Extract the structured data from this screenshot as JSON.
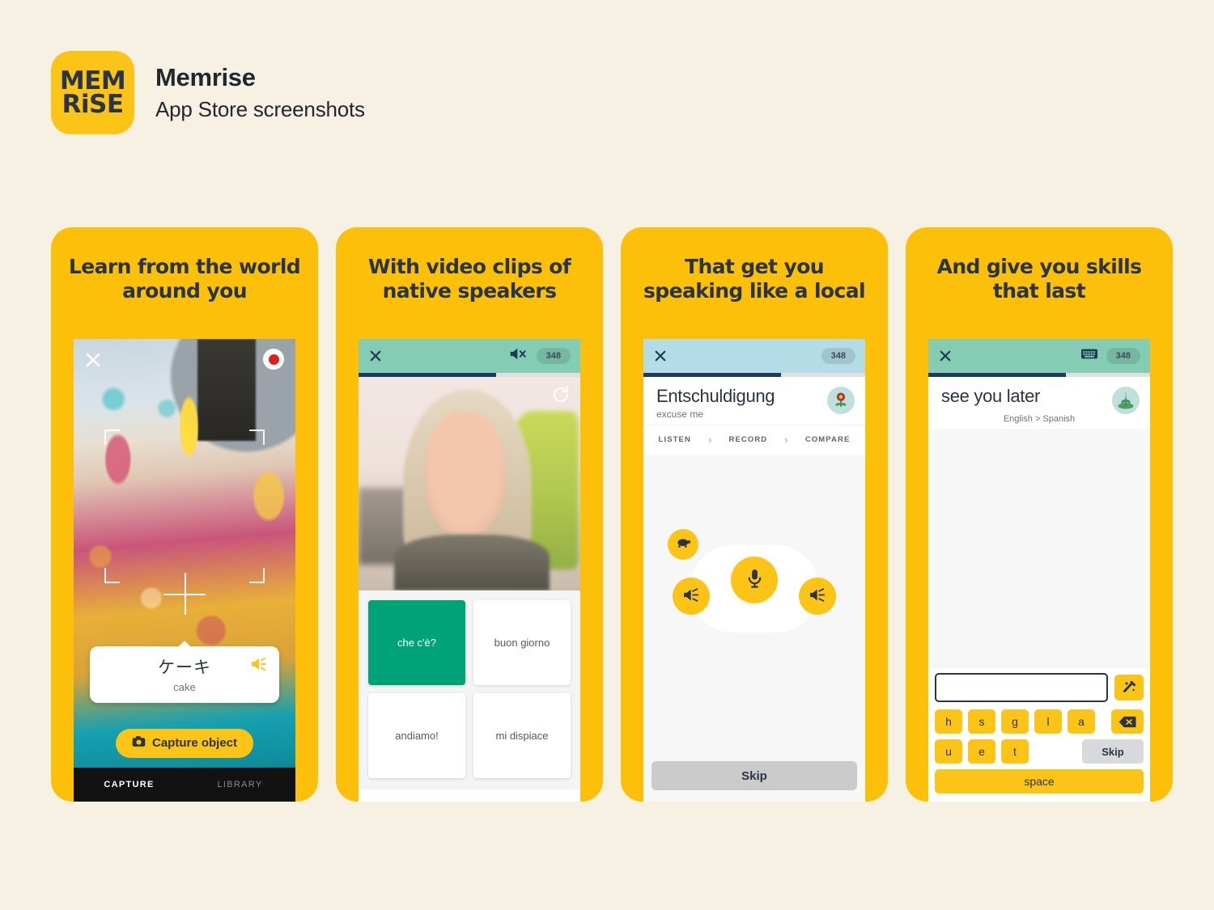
{
  "brand": {
    "logo_line1": "MEM",
    "logo_line2": "RiSE",
    "title": "Memrise",
    "subtitle": "App Store screenshots"
  },
  "panels": [
    {
      "headline": "Learn from the world around you",
      "close_icon": "close-icon",
      "record_icon": "record-dot-icon",
      "word_card": {
        "term": "ケーキ",
        "translation": "cake",
        "speaker_icon": "speaker-icon"
      },
      "capture_button": {
        "label": "Capture object",
        "icon": "camera-icon"
      },
      "tabs": [
        {
          "label": "CAPTURE",
          "active": true
        },
        {
          "label": "LIBRARY",
          "active": false
        }
      ]
    },
    {
      "headline": "With video clips of native speakers",
      "appbar": {
        "close_icon": "close-icon",
        "mute_icon": "speaker-muted-icon",
        "points_badge": "348",
        "bar_color": "#84CCB4",
        "progress_percent": 62
      },
      "video": {
        "replay_icon": "replay-icon"
      },
      "tiles": [
        {
          "label": "che c'è?",
          "selected": true
        },
        {
          "label": "buon giorno",
          "selected": false
        },
        {
          "label": "andiamo!",
          "selected": false
        },
        {
          "label": "mi dispiace",
          "selected": false
        }
      ],
      "selected_color": "#00A377"
    },
    {
      "headline": "That get you speaking like a local",
      "appbar": {
        "close_icon": "close-icon",
        "points_badge": "348",
        "bar_color": "#B4DCE7",
        "progress_percent": 62
      },
      "prompt": {
        "term": "Entschuldigung",
        "translation": "excuse me",
        "avatar_icon": "flower-icon"
      },
      "steps": [
        "LISTEN",
        "RECORD",
        "COMPARE"
      ],
      "step_separator": "›",
      "controls": [
        {
          "name": "slow-playback-button",
          "icon": "turtle-icon"
        },
        {
          "name": "record-microphone-button",
          "icon": "microphone-icon"
        },
        {
          "name": "play-left-button",
          "icon": "speaker-icon"
        },
        {
          "name": "play-right-button",
          "icon": "speaker-icon"
        }
      ],
      "skip_label": "Skip"
    },
    {
      "headline": "And give you skills that last",
      "appbar": {
        "close_icon": "close-icon",
        "keyboard_icon": "keyboard-icon",
        "points_badge": "348",
        "bar_color": "#84CCB4",
        "progress_percent": 62
      },
      "prompt": {
        "term": "see you later",
        "direction": "English > Spanish",
        "avatar_icon": "sprout-icon"
      },
      "answer_input": {
        "value": "",
        "placeholder": ""
      },
      "hint_button_icon": "magic-wand-icon",
      "keyboard": {
        "row1": [
          "h",
          "s",
          "g",
          "l",
          "a"
        ],
        "backspace_icon": "backspace-icon",
        "row2": [
          "u",
          "e",
          "t"
        ],
        "skip_label": "Skip",
        "space_label": "space"
      }
    }
  ],
  "colors": {
    "background": "#F7F1E3",
    "panel_yellow": "#FCC00A",
    "brand_yellow": "#FBC416",
    "ink": "#2B3442",
    "teal_bar": "#84CCB4",
    "blue_bar": "#B4DCE7",
    "progress": "#1E3A5F",
    "tile_selected": "#00A377",
    "skip_grey": "#CBCBCB"
  }
}
